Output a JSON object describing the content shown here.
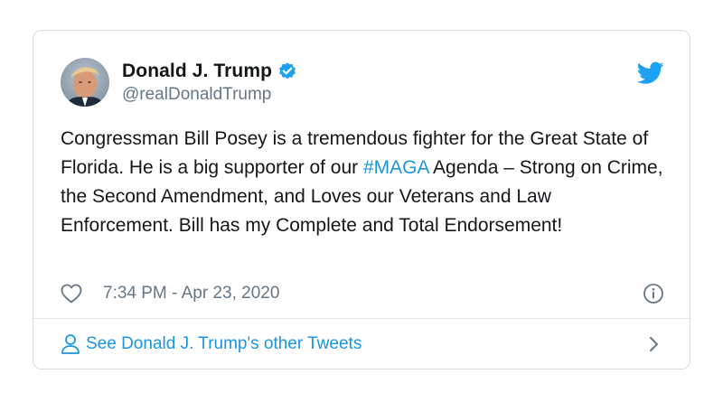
{
  "tweet": {
    "author": {
      "name": "Donald J. Trump",
      "handle": "@realDonaldTrump",
      "verified": true
    },
    "text": {
      "before_hashtag": "Congressman Bill Posey is a tremendous fighter for the Great State of Florida. He is a big supporter of our ",
      "hashtag": "#MAGA",
      "after_hashtag": " Agenda – Strong on Crime, the Second Amendment, and Loves our Veterans and Law Enforcement. Bill has my Complete and Total Endorsement!"
    },
    "timestamp": "7:34 PM - Apr 23, 2020",
    "footer_link": "See Donald J. Trump's other Tweets"
  },
  "colors": {
    "accent": "#1b95e0",
    "twitter_blue": "#1da1f2",
    "secondary_text": "#657786",
    "border": "#d6dde3"
  },
  "icons": [
    "avatar-photo",
    "verified-badge-icon",
    "twitter-bird-icon",
    "heart-icon",
    "info-icon",
    "person-icon",
    "chevron-right-icon"
  ]
}
